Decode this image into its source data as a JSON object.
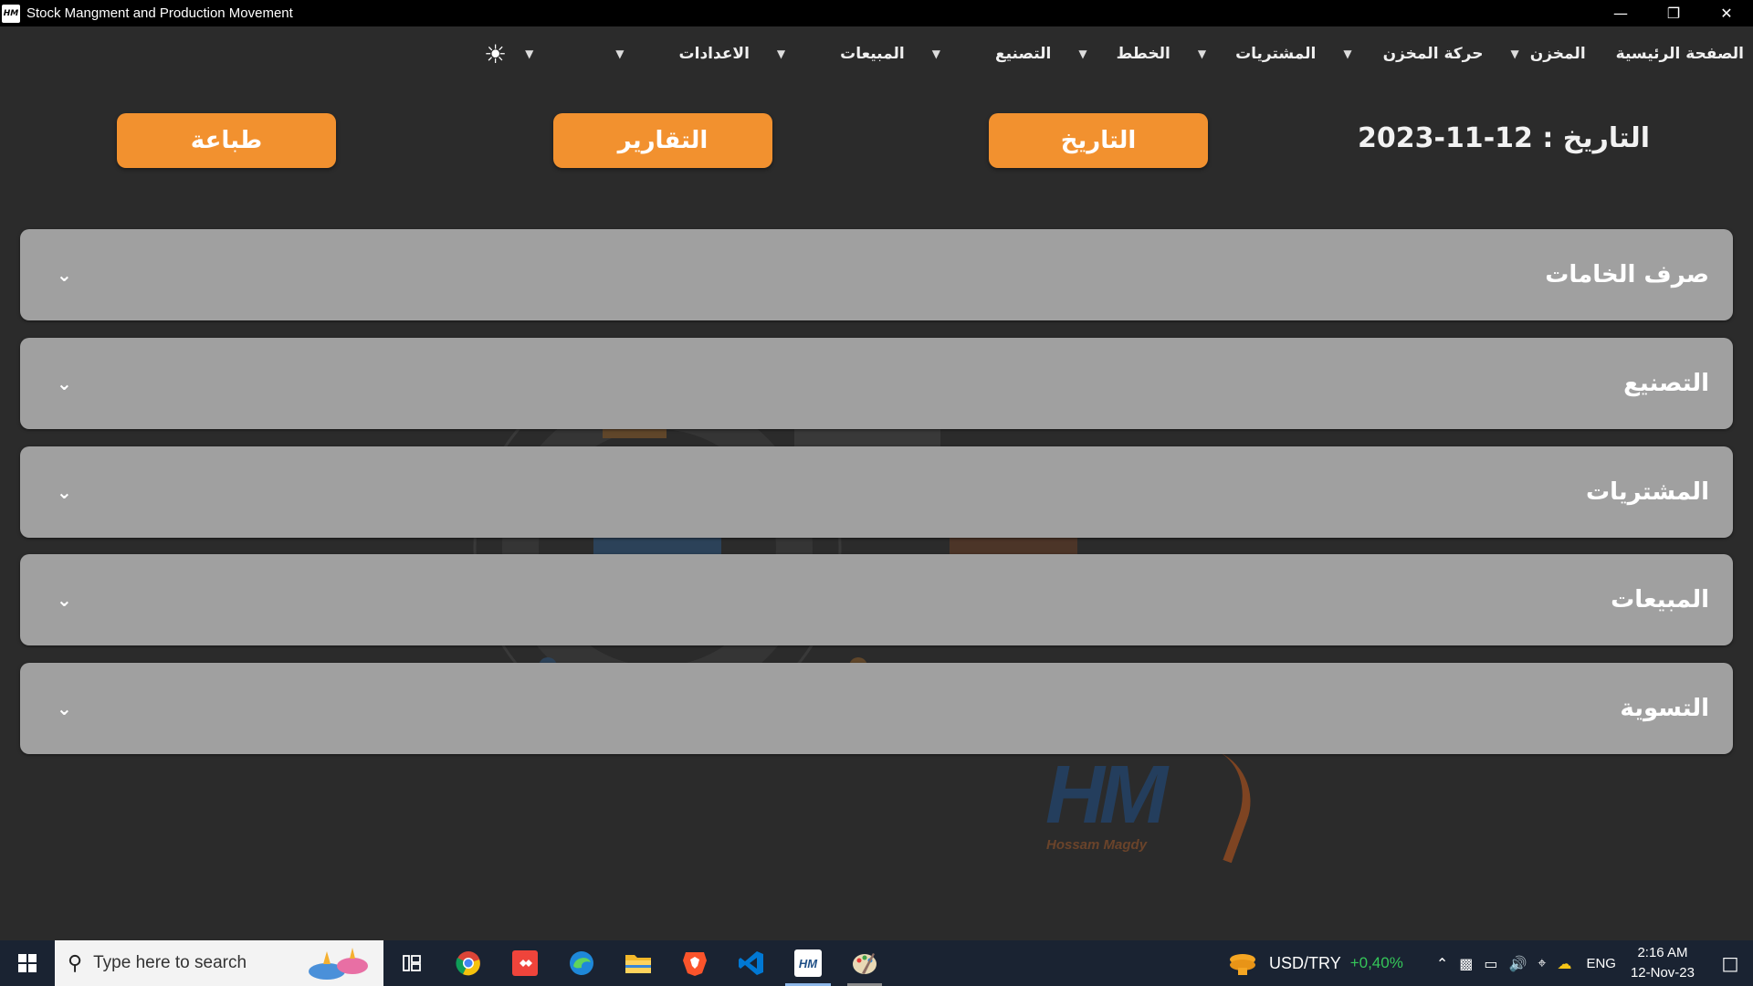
{
  "window": {
    "title": "Stock Mangment and Production Movement",
    "icon_text": "HM",
    "controls": [
      "minimize-icon",
      "restore-icon",
      "close-icon"
    ]
  },
  "menu": {
    "items": [
      {
        "label": "الصفحة الرئيسية",
        "has_caret": false
      },
      {
        "label": "المخزن",
        "has_caret": true
      },
      {
        "label": "حركة المخزن",
        "has_caret": true
      },
      {
        "label": "المشتريات",
        "has_caret": true
      },
      {
        "label": "الخطط",
        "has_caret": true
      },
      {
        "label": "التصنيع",
        "has_caret": true
      },
      {
        "label": "المبيعات",
        "has_caret": true
      },
      {
        "label": "الاعدادات",
        "has_caret": true
      }
    ],
    "theme_icon": "sun-icon"
  },
  "toolbar": {
    "date_text": "التاريخ : 12-11-2023",
    "date_button": "التاريخ",
    "reports_button": "التقارير",
    "print_button": "طباعة",
    "accent_color": "#f2912f"
  },
  "sections": [
    {
      "title": "صرف الخامات"
    },
    {
      "title": "التصنيع"
    },
    {
      "title": "المشتريات"
    },
    {
      "title": "المبيعات"
    },
    {
      "title": "التسوية"
    }
  ],
  "watermark": {
    "logo_text": "HM",
    "author": "Hossam Magdy"
  },
  "taskbar": {
    "search_placeholder": "Type here to search",
    "apps": [
      "task-view-icon",
      "chrome-icon",
      "anydesk-icon",
      "edge-icon",
      "file-explorer-icon",
      "brave-icon",
      "vscode-icon",
      "hm-app-icon",
      "paint-icon"
    ],
    "ticker_symbol": "USD/TRY",
    "ticker_change": "+0,40%",
    "language": "ENG",
    "time": "2:16 AM",
    "date": "12-Nov-23"
  }
}
